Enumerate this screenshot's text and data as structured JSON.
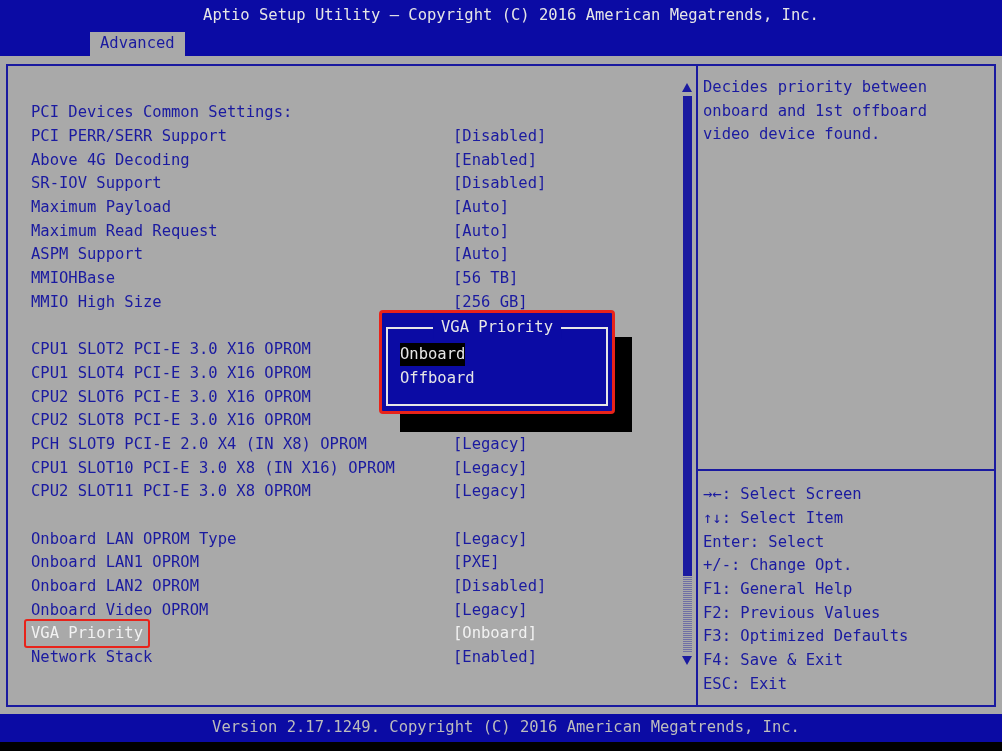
{
  "window": {
    "title": "Aptio Setup Utility – Copyright (C) 2016 American Megatrends, Inc."
  },
  "tabs": [
    {
      "label": "Advanced",
      "selected": true
    }
  ],
  "rows": [
    {
      "kind": "header",
      "label": "PCI Devices Common Settings:"
    },
    {
      "kind": "setting",
      "label": "PCI PERR/SERR Support",
      "value": "[Disabled]",
      "selected": false,
      "highlighted": false
    },
    {
      "kind": "setting",
      "label": "Above 4G Decoding",
      "value": "[Enabled]",
      "selected": false,
      "highlighted": false
    },
    {
      "kind": "setting",
      "label": "SR-IOV Support",
      "value": "[Disabled]",
      "selected": false,
      "highlighted": false
    },
    {
      "kind": "setting",
      "label": "Maximum Payload",
      "value": "[Auto]",
      "selected": false,
      "highlighted": false
    },
    {
      "kind": "setting",
      "label": "Maximum Read Request",
      "value": "[Auto]",
      "selected": false,
      "highlighted": false
    },
    {
      "kind": "setting",
      "label": "ASPM Support",
      "value": "[Auto]",
      "selected": false,
      "highlighted": false
    },
    {
      "kind": "setting",
      "label": "MMIOHBase",
      "value": "[56 TB]",
      "selected": false,
      "highlighted": false
    },
    {
      "kind": "setting",
      "label": "MMIO High Size",
      "value": "[256 GB]",
      "selected": false,
      "highlighted": false
    },
    {
      "kind": "blank"
    },
    {
      "kind": "setting",
      "label": "CPU1 SLOT2 PCI-E 3.0 X16 OPROM",
      "selected": false,
      "highlighted": false
    },
    {
      "kind": "setting",
      "label": "CPU1 SLOT4 PCI-E 3.0 X16 OPROM",
      "selected": false,
      "highlighted": false
    },
    {
      "kind": "setting",
      "label": "CPU2 SLOT6 PCI-E 3.0 X16 OPROM",
      "selected": false,
      "highlighted": false
    },
    {
      "kind": "setting",
      "label": "CPU2 SLOT8 PCI-E 3.0 X16 OPROM",
      "selected": false,
      "highlighted": false
    },
    {
      "kind": "setting",
      "label": "PCH SLOT9 PCI-E 2.0 X4 (IN X8) OPROM",
      "value": "[Legacy]",
      "selected": false,
      "highlighted": false
    },
    {
      "kind": "setting",
      "label": "CPU1 SLOT10 PCI-E 3.0 X8 (IN X16) OPROM",
      "value": "[Legacy]",
      "selected": false,
      "highlighted": false
    },
    {
      "kind": "setting",
      "label": "CPU2 SLOT11 PCI-E 3.0 X8 OPROM",
      "value": "[Legacy]",
      "selected": false,
      "highlighted": false
    },
    {
      "kind": "blank"
    },
    {
      "kind": "setting",
      "label": "Onboard LAN OPROM Type",
      "value": "[Legacy]",
      "selected": false,
      "highlighted": false
    },
    {
      "kind": "setting",
      "label": "Onboard LAN1 OPROM",
      "value": "[PXE]",
      "selected": false,
      "highlighted": false
    },
    {
      "kind": "setting",
      "label": "Onboard LAN2 OPROM",
      "value": "[Disabled]",
      "selected": false,
      "highlighted": false
    },
    {
      "kind": "setting",
      "label": "Onboard Video OPROM",
      "value": "[Legacy]",
      "selected": false,
      "highlighted": false
    },
    {
      "kind": "setting",
      "label": "VGA Priority",
      "value": "[Onboard]",
      "selected": true,
      "highlighted": true
    },
    {
      "kind": "setting",
      "label": "Network Stack",
      "value": "[Enabled]",
      "selected": false,
      "highlighted": false
    }
  ],
  "popup": {
    "title": "VGA Priority",
    "highlighted": true,
    "options": [
      {
        "label": "Onboard",
        "selected": true
      },
      {
        "label": "Offboard",
        "selected": false
      }
    ]
  },
  "help": {
    "text": "Decides priority between onboard and 1st offboard video device found."
  },
  "keys": [
    "→←: Select Screen",
    "↑↓: Select Item",
    "Enter: Select",
    "+/-: Change Opt.",
    "F1: General Help",
    "F2: Previous Values",
    "F3: Optimized Defaults",
    "F4: Save & Exit",
    "ESC: Exit"
  ],
  "status_bar": {
    "text": "Version 2.17.1249. Copyright (C) 2016 American Megatrends, Inc."
  }
}
